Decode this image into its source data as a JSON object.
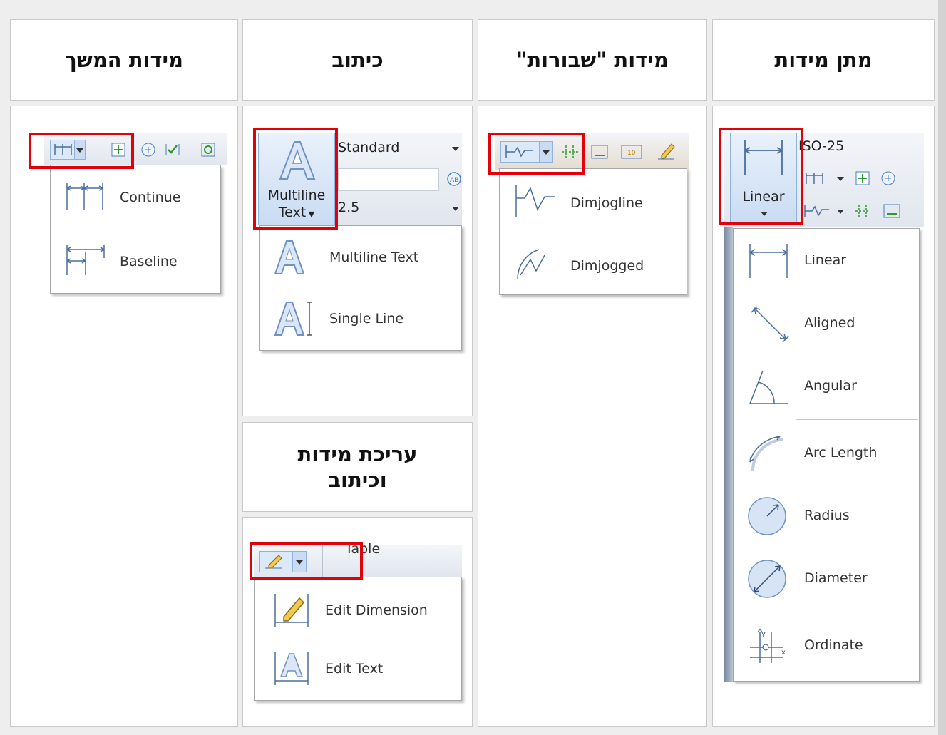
{
  "headers": {
    "dimensions": "מתן מידות",
    "jogged": "מידות \"שבורות\"",
    "text": "כיתוב",
    "continue": "מידות המשך",
    "edit": "עריכת מידות וכיתוב"
  },
  "dim_panel": {
    "style_value": "ISO-25",
    "button_label": "Linear",
    "items": [
      {
        "label": "Linear",
        "icon": "linear-dim-icon"
      },
      {
        "label": "Aligned",
        "icon": "aligned-dim-icon"
      },
      {
        "label": "Angular",
        "icon": "angular-dim-icon"
      },
      {
        "label": "Arc Length",
        "icon": "arc-length-icon"
      },
      {
        "label": "Radius",
        "icon": "radius-icon"
      },
      {
        "label": "Diameter",
        "icon": "diameter-icon"
      },
      {
        "label": "Ordinate",
        "icon": "ordinate-icon"
      }
    ]
  },
  "jog_panel": {
    "items": [
      {
        "label": "Dimjogline",
        "icon": "dimjogline-icon"
      },
      {
        "label": "Dimjogged",
        "icon": "dimjogged-icon"
      }
    ]
  },
  "text_panel": {
    "style_value": "Standard",
    "height_value": "2.5",
    "button_line1": "Multiline",
    "button_line2": "Text",
    "items": [
      {
        "label": "Multiline Text",
        "icon": "multiline-text-icon"
      },
      {
        "label": "Single Line",
        "icon": "single-line-text-icon"
      }
    ]
  },
  "continue_panel": {
    "items": [
      {
        "label": "Continue",
        "icon": "continue-dim-icon"
      },
      {
        "label": "Baseline",
        "icon": "baseline-dim-icon"
      }
    ]
  },
  "edit_panel": {
    "table_label": "Table",
    "items": [
      {
        "label": "Edit Dimension",
        "icon": "edit-dimension-icon"
      },
      {
        "label": "Edit Text",
        "icon": "edit-text-icon"
      }
    ]
  },
  "colors": {
    "highlight": "#e3000b",
    "ribbon": "#dfe6f0",
    "accent": "#4a7ebb"
  }
}
